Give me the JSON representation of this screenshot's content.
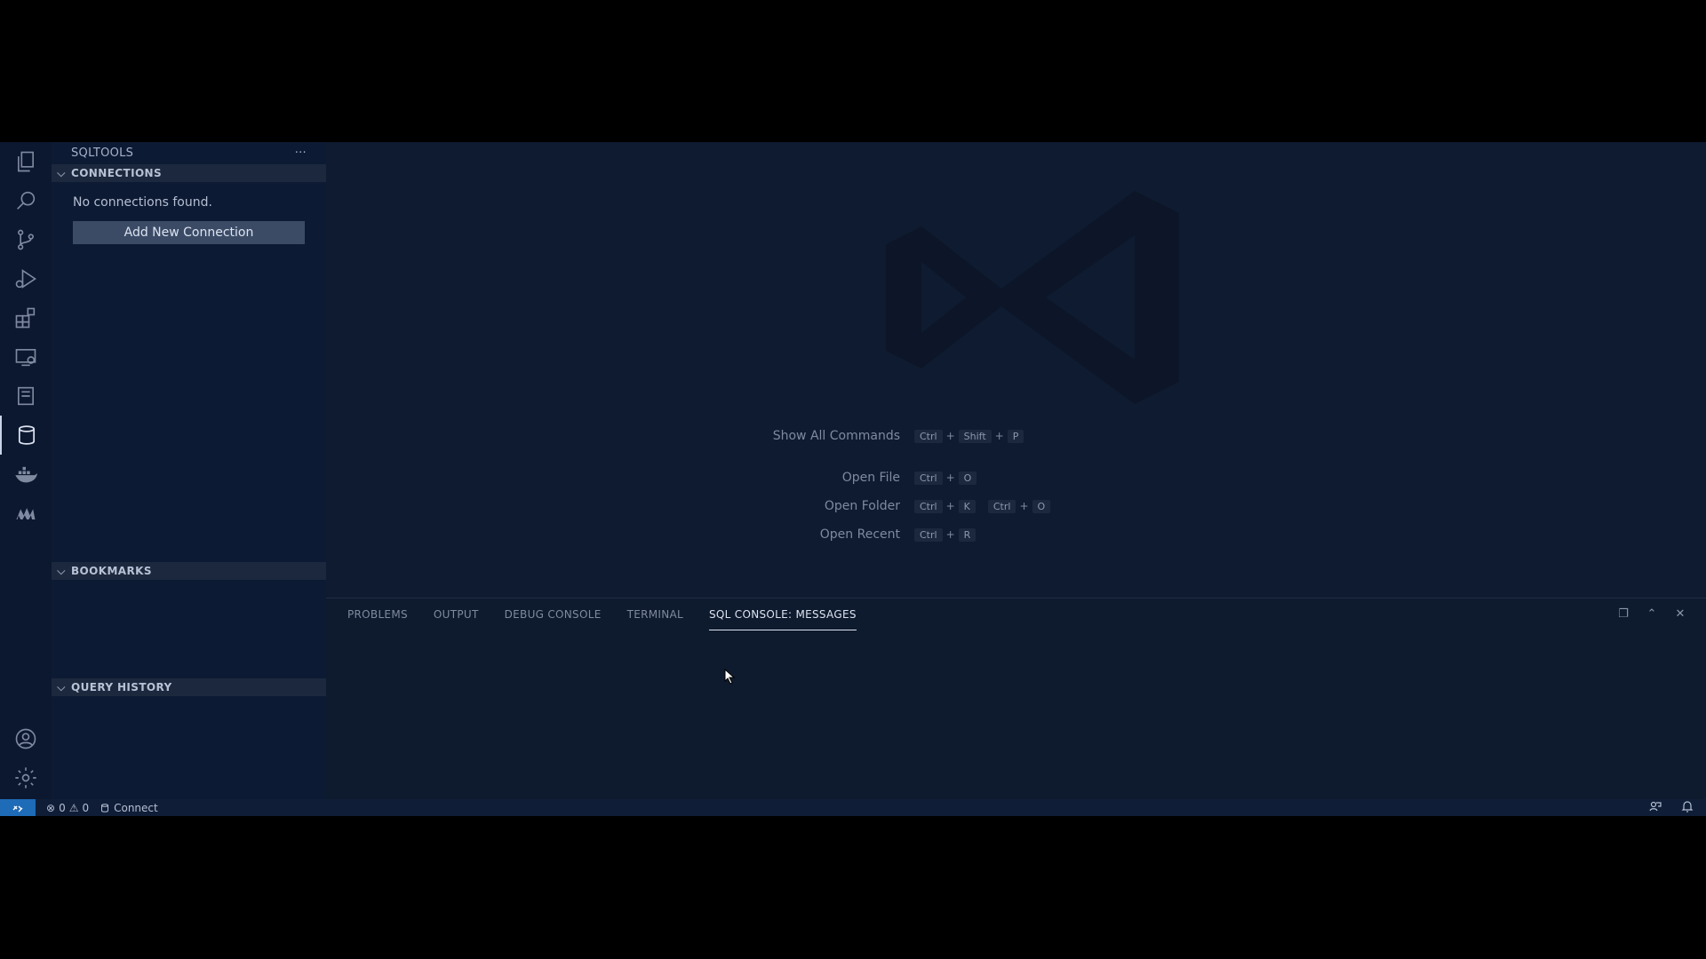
{
  "sidebar": {
    "title": "SQLTOOLS",
    "more_label": "···",
    "connections": {
      "header": "CONNECTIONS",
      "empty_text": "No connections found.",
      "add_button": "Add New Connection"
    },
    "bookmarks_header": "BOOKMARKS",
    "history_header": "QUERY HISTORY"
  },
  "activity_bar": {
    "icons": [
      "explorer-icon",
      "search-icon",
      "source-control-icon",
      "run-debug-icon",
      "extensions-icon",
      "remote-explorer-icon",
      "notebook-icon",
      "database-icon",
      "docker-icon",
      "mongodb-icon",
      "account-icon",
      "settings-gear-icon"
    ],
    "active": "database-icon"
  },
  "welcome": {
    "shortcuts": [
      {
        "label": "Show All Commands",
        "keys": [
          [
            "Ctrl",
            "Shift",
            "P"
          ]
        ]
      },
      {
        "label": "Open File",
        "keys": [
          [
            "Ctrl",
            "O"
          ]
        ]
      },
      {
        "label": "Open Folder",
        "keys": [
          [
            "Ctrl",
            "K"
          ],
          [
            "Ctrl",
            "O"
          ]
        ]
      },
      {
        "label": "Open Recent",
        "keys": [
          [
            "Ctrl",
            "R"
          ]
        ]
      }
    ]
  },
  "panel": {
    "tabs": [
      "PROBLEMS",
      "OUTPUT",
      "DEBUG CONSOLE",
      "TERMINAL",
      "SQL CONSOLE: MESSAGES"
    ],
    "active_tab": "SQL CONSOLE: MESSAGES"
  },
  "status": {
    "errors": "0",
    "warnings": "0",
    "connect_label": "Connect"
  },
  "colors": {
    "background": "#0f1b30",
    "status_remote": "#1e6bb8",
    "button": "#3b4b66"
  }
}
